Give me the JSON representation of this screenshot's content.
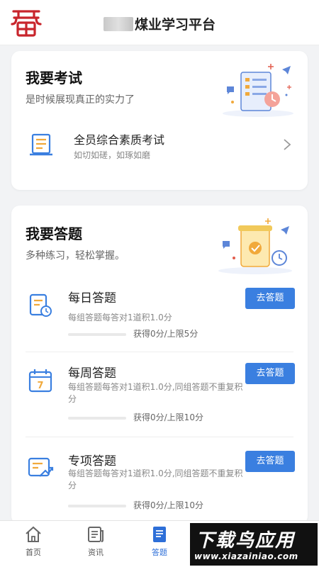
{
  "header": {
    "title": "煤业学习平台",
    "logo_icon": "red-seal-logo"
  },
  "exam_card": {
    "title": "我要考试",
    "subtitle": "是时候展现真正的实力了",
    "item": {
      "name": "全员综合素质考试",
      "desc": "如切如磋，如琢如磨"
    }
  },
  "answer_card": {
    "title": "我要答题",
    "subtitle": "多种练习，轻松掌握。",
    "items": [
      {
        "name": "每日答题",
        "desc": "每组答题每答对1道积1.0分",
        "score": "获得0分/上限5分",
        "button": "去答题",
        "progress": 0
      },
      {
        "name": "每周答题",
        "desc": "每组答题每答对1道积1.0分,同组答题不重复积分",
        "score": "获得0分/上限10分",
        "button": "去答题",
        "progress": 0
      },
      {
        "name": "专项答题",
        "desc": "每组答题每答对1道积1.0分,同组答题不重复积分",
        "score": "获得0分/上限10分",
        "button": "去答题",
        "progress": 0
      }
    ]
  },
  "tabbar": {
    "tabs": [
      {
        "label": "首页"
      },
      {
        "label": "资讯"
      },
      {
        "label": "答题"
      }
    ]
  },
  "watermark": {
    "main": "下载鸟应用",
    "sub": "www.xiazainiao.com"
  },
  "colors": {
    "accent": "#3a7fe0",
    "logo_red": "#c8252c",
    "active_tab": "#2e6fd8"
  }
}
